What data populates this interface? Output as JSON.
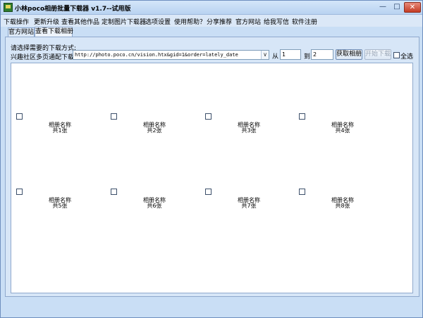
{
  "window": {
    "title": "小林poco相册批量下载器 v1.7--试用版",
    "min": "—",
    "max": "□",
    "close": "✕"
  },
  "menu": [
    "下载操作",
    "更新升级",
    "查看其他作品",
    "定制图片下载器",
    "选项设置",
    "使用帮助？",
    "分享推荐",
    "官方网站",
    "给我写信",
    "软件注册"
  ],
  "tabs": [
    {
      "label": "官方网站",
      "active": false
    },
    {
      "label": "查看下载相册",
      "active": true
    }
  ],
  "download": {
    "method_label": "请选择需要的下载方式:",
    "url_label": "兴趣社区多页通配下载:",
    "url_value": "http://photo.poco.cn/vision.htx&gid=1&order=lately_date",
    "url_arrow": "∨",
    "from_label": "从",
    "from_value": "1",
    "to_label": "到",
    "to_value": "2",
    "get_button": "获取相册",
    "start_button": "开始下载",
    "select_all": "全选"
  },
  "albums": [
    {
      "name": "相册名称",
      "count": "共1张"
    },
    {
      "name": "相册名称",
      "count": "共2张"
    },
    {
      "name": "相册名称",
      "count": "共3张"
    },
    {
      "name": "相册名称",
      "count": "共4张"
    },
    {
      "name": "相册名称",
      "count": "共5张"
    },
    {
      "name": "相册名称",
      "count": "共6张"
    },
    {
      "name": "相册名称",
      "count": "共7张"
    },
    {
      "name": "相册名称",
      "count": "共8张"
    }
  ]
}
